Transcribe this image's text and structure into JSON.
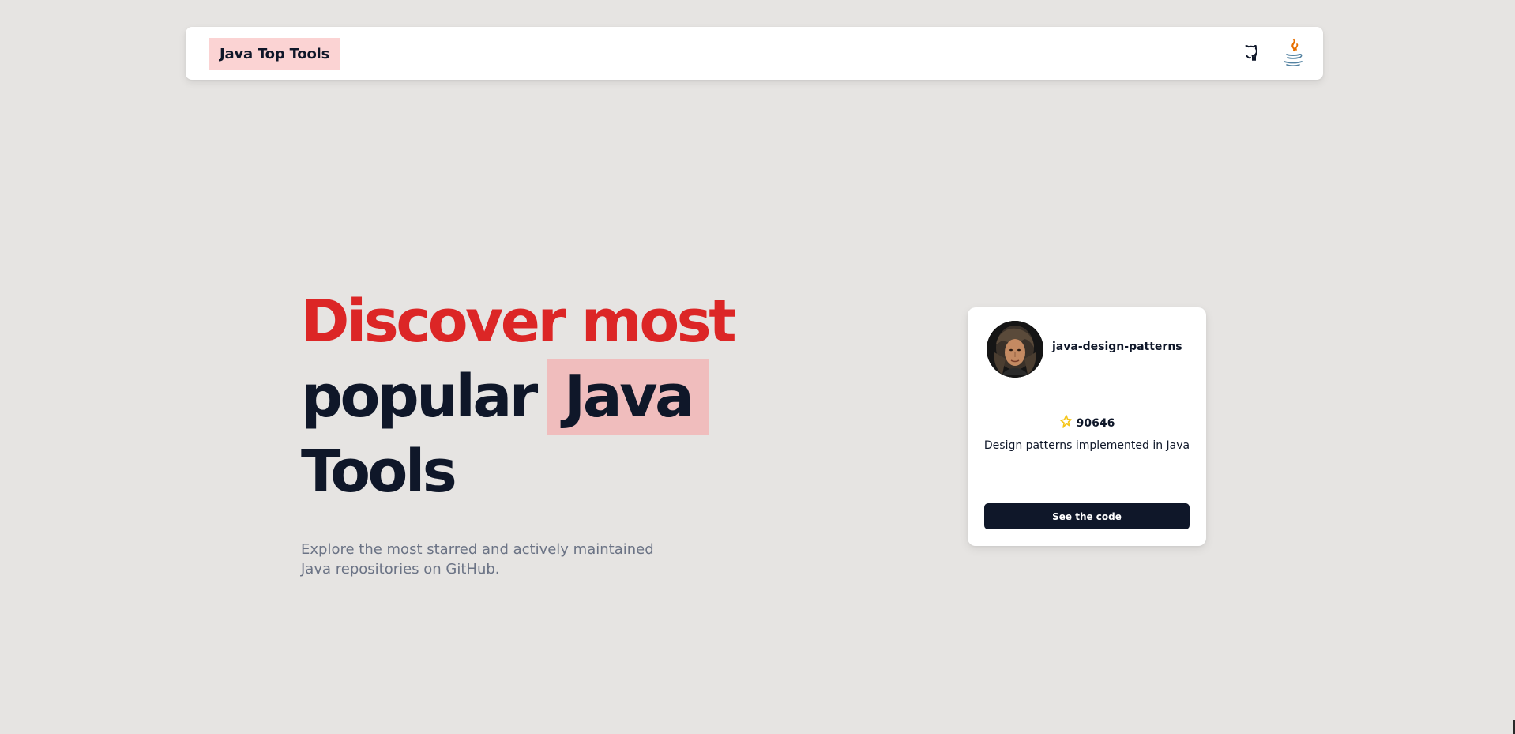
{
  "nav": {
    "brand": "Java Top Tools",
    "icons": {
      "github": "github-icon",
      "java": "java-icon"
    }
  },
  "hero": {
    "title_line1": "Discover most",
    "title_line2_prefix": "popular",
    "title_line2_highlight": "Java",
    "title_line3": "Tools",
    "subtitle": "Explore the most starred and actively maintained Java repositories on GitHub."
  },
  "card": {
    "repo_name": "java-design-patterns",
    "stars": "90646",
    "description": "Design patterns implemented in Java",
    "button_label": "See the code",
    "icons": {
      "avatar": "avatar",
      "star": "star-icon"
    }
  },
  "colors": {
    "background": "#e6e4e2",
    "accent_red": "#dc2626",
    "highlight_pink": "#f0bdbd",
    "brand_pink": "#fbd3d3",
    "dark": "#0f1729",
    "muted_text": "#6b7385",
    "star_yellow": "#f5c518"
  }
}
